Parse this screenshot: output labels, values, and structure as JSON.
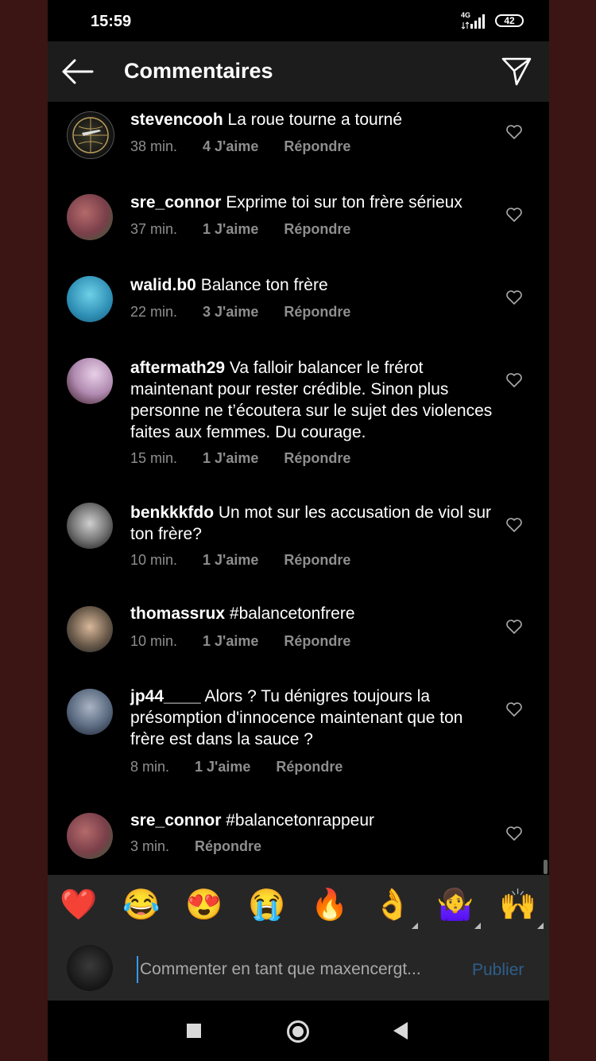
{
  "status_bar": {
    "time": "15:59",
    "network": "4G",
    "battery": "42"
  },
  "header": {
    "title": "Commentaires"
  },
  "comments": [
    {
      "user": "stevencooh",
      "text": "La roue tourne a tourné",
      "time": "38 min.",
      "likes": "4 J'aime",
      "reply": "Répondre"
    },
    {
      "user": "sre_connor",
      "text": "Exprime toi sur ton frère sérieux",
      "time": "37 min.",
      "likes": "1 J'aime",
      "reply": "Répondre"
    },
    {
      "user": "walid.b0",
      "text": "Balance ton frère",
      "time": "22 min.",
      "likes": "3 J'aime",
      "reply": "Répondre"
    },
    {
      "user": "aftermath29",
      "text": "Va falloir balancer le frérot maintenant pour rester crédible. Sinon plus personne ne t’écoutera sur le sujet des violences faites aux femmes. Du courage.",
      "time": "15 min.",
      "likes": "1 J'aime",
      "reply": "Répondre"
    },
    {
      "user": "benkkkfdo",
      "text": "Un mot sur les accusation de viol sur ton frère?",
      "time": "10 min.",
      "likes": "1 J'aime",
      "reply": "Répondre"
    },
    {
      "user": "thomassrux",
      "text": "#balancetonfrere",
      "time": "10 min.",
      "likes": "1 J'aime",
      "reply": "Répondre"
    },
    {
      "user": "jp44____",
      "text": "Alors ? Tu dénigres toujours la présomption d'innocence maintenant que ton frère est dans la sauce ?",
      "time": "8 min.",
      "likes": "1 J'aime",
      "reply": "Répondre"
    },
    {
      "user": "sre_connor",
      "text": "#balancetonrappeur",
      "time": "3 min.",
      "likes": "",
      "reply": "Répondre"
    }
  ],
  "emojis": [
    "❤️",
    "😂",
    "😍",
    "😭",
    "🔥",
    "👌",
    "🤷‍♀️",
    "🙌"
  ],
  "composer": {
    "placeholder": "Commenter en tant que maxencergt...",
    "publish": "Publier"
  },
  "colors": {
    "background": "#000000",
    "header": "#1c1c1c",
    "panel": "#262626",
    "muted": "#8e8e8e",
    "publish": "#2d5f8c"
  }
}
